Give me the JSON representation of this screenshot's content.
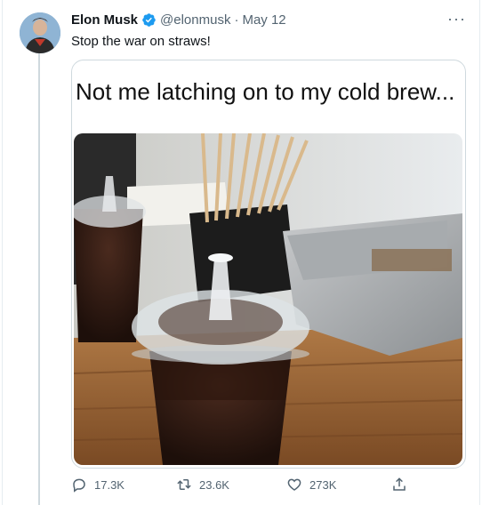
{
  "tweet": {
    "author_name": "Elon Musk",
    "handle": "@elonmusk",
    "separator": "·",
    "date": "May 12",
    "text": "Stop the war on straws!",
    "more_label": "···"
  },
  "media": {
    "meme_caption": "Not me latching on to my cold brew..."
  },
  "actions": {
    "reply_count": "17.3K",
    "retweet_count": "23.6K",
    "like_count": "273K"
  },
  "colors": {
    "text_primary": "#0f1419",
    "text_secondary": "#536471",
    "verified_blue": "#1d9bf0",
    "border": "#cfd9de"
  },
  "icons": {
    "verified": "verified-badge-icon",
    "more": "more-icon",
    "reply": "reply-icon",
    "retweet": "retweet-icon",
    "like": "like-icon",
    "share": "share-icon"
  }
}
